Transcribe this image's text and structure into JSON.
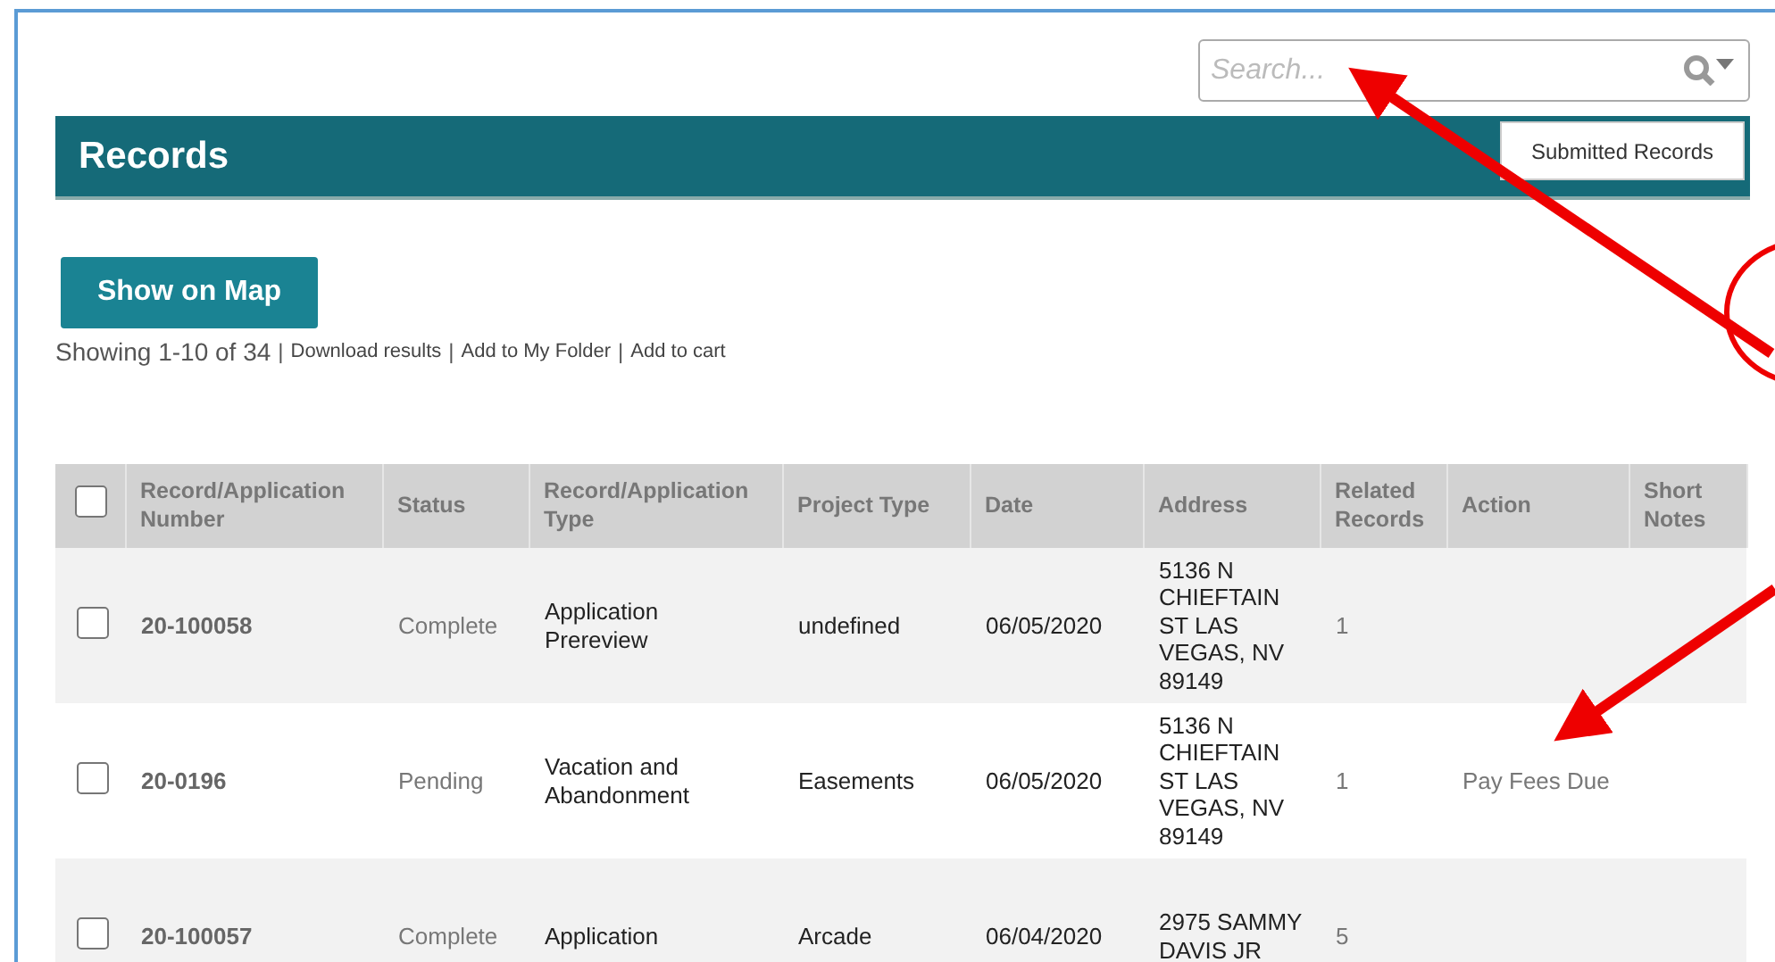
{
  "search": {
    "placeholder": "Search..."
  },
  "header": {
    "title": "Records",
    "button": "Submitted Records"
  },
  "map_button": "Show on Map",
  "summary": {
    "showing": "Showing 1-10 of 34",
    "links": [
      {
        "separator": "|",
        "label": "Download results"
      },
      {
        "separator": "|",
        "label": "Add to My Folder"
      },
      {
        "separator": "|",
        "label": "Add to cart"
      }
    ]
  },
  "table": {
    "select_all": {
      "checked": false
    },
    "columns": [
      "Record/Application Number",
      "Status",
      "Record/Application Type",
      "Project Type",
      "Date",
      "Address",
      "Related Records",
      "Action",
      "Short Notes"
    ],
    "rows": [
      {
        "checked": false,
        "number": "20-100058",
        "status": "Complete",
        "type": "Application Prereview",
        "project_type": "undefined",
        "date": "06/05/2020",
        "address": "5136 N CHIEFTAIN ST LAS VEGAS, NV 89149",
        "related": "1"
      },
      {
        "checked": false,
        "number": "20-0196",
        "status": "Pending",
        "type": "Vacation and Abandonment",
        "project_type": "Easements",
        "date": "06/05/2020",
        "address": "5136 N CHIEFTAIN ST LAS VEGAS, NV 89149",
        "related": "1",
        "action": "Pay Fees Due"
      },
      {
        "checked": false,
        "number": "20-100057",
        "status": "Complete",
        "type": "Application",
        "project_type": "Arcade",
        "date": "06/04/2020",
        "address": "2975 SAMMY DAVIS JR",
        "related": "5"
      }
    ]
  }
}
